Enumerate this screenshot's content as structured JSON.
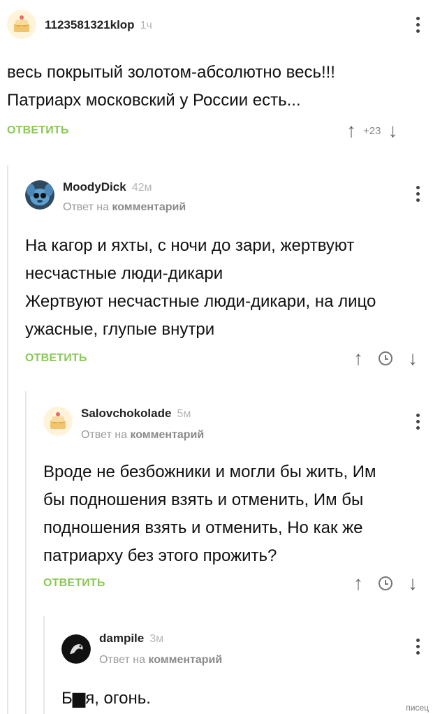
{
  "comments": [
    {
      "username": "1123581321klop",
      "time": "1ч",
      "reply_subtitle": "",
      "body": [
        "весь покрытый золотом-абсолютно весь!!!",
        "Патриарх московский у России есть..."
      ],
      "reply_label": "ОТВЕТИТЬ",
      "rating": "+23",
      "avatar_icon": "cake-avatar-icon"
    },
    {
      "username": "MoodyDick",
      "time": "42м",
      "reply_subtitle_prefix": "Ответ на",
      "reply_subtitle_link": "комментарий",
      "body": [
        "На кагор и яхты, с ночи до зари, жертвуют",
        "несчастные люди-дикари",
        "Жертвуют несчастные люди-дикари, на лицо",
        "ужасные, глупые внутри"
      ],
      "reply_label": "ОТВЕТИТЬ",
      "avatar_icon": "stitch-avatar-icon"
    },
    {
      "username": "Salovchokolade",
      "time": "5м",
      "reply_subtitle_prefix": "Ответ на",
      "reply_subtitle_link": "комментарий",
      "body": [
        "Вроде не безбожники и могли бы жить, Им",
        "бы подношения взять и отменить, Им бы",
        "подношения взять и отменить, Но как же",
        "патриарху без этого прожить?"
      ],
      "reply_label": "ОТВЕТИТЬ",
      "avatar_icon": "cake-avatar-icon"
    },
    {
      "username": "dampile",
      "time": "3м",
      "reply_subtitle_prefix": "Ответ на",
      "reply_subtitle_link": "комментарий",
      "body": [
        "Б▆я, огонь."
      ],
      "avatar_icon": "black-dragon-avatar-icon"
    }
  ],
  "watermark": "писец",
  "colors": {
    "reply": "#8ac858",
    "thread_line": "#e6e6e6"
  }
}
